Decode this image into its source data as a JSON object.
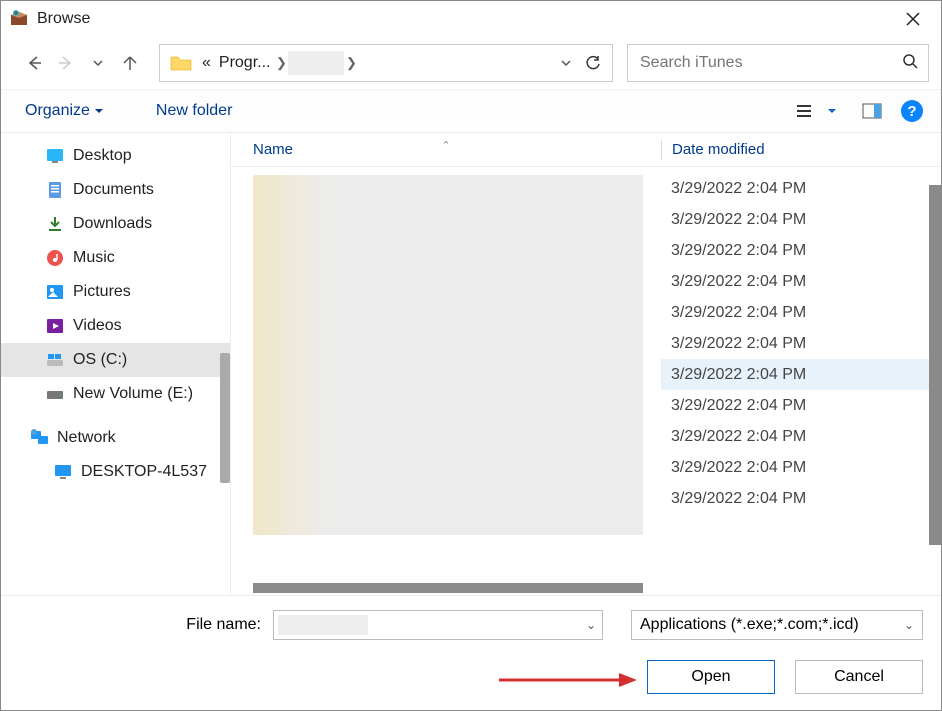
{
  "window": {
    "title": "Browse"
  },
  "nav": {
    "breadcrumb_root_glyph": "«",
    "breadcrumb_item1": "Progr...",
    "breadcrumb_item2_hidden": true
  },
  "search": {
    "placeholder": "Search iTunes"
  },
  "toolbar": {
    "organize": "Organize",
    "new_folder": "New folder"
  },
  "sidebar": {
    "items": [
      {
        "label": "Desktop",
        "icon": "desktop"
      },
      {
        "label": "Documents",
        "icon": "documents"
      },
      {
        "label": "Downloads",
        "icon": "downloads"
      },
      {
        "label": "Music",
        "icon": "music"
      },
      {
        "label": "Pictures",
        "icon": "pictures"
      },
      {
        "label": "Videos",
        "icon": "videos"
      },
      {
        "label": "OS (C:)",
        "icon": "drive",
        "selected": true
      },
      {
        "label": "New Volume (E:)",
        "icon": "drive2"
      }
    ],
    "network_label": "Network",
    "network_item": "DESKTOP-4L537"
  },
  "columns": {
    "name": "Name",
    "date": "Date modified"
  },
  "rows": [
    {
      "date": "3/29/2022 2:04 PM"
    },
    {
      "date": "3/29/2022 2:04 PM"
    },
    {
      "date": "3/29/2022 2:04 PM"
    },
    {
      "date": "3/29/2022 2:04 PM"
    },
    {
      "date": "3/29/2022 2:04 PM"
    },
    {
      "date": "3/29/2022 2:04 PM"
    },
    {
      "date": "3/29/2022 2:04 PM",
      "selected": true
    },
    {
      "date": "3/29/2022 2:04 PM"
    },
    {
      "date": "3/29/2022 2:04 PM"
    },
    {
      "date": "3/29/2022 2:04 PM"
    },
    {
      "date": "3/29/2022 2:04 PM"
    }
  ],
  "filename": {
    "label": "File name:",
    "value": "",
    "filter": "Applications (*.exe;*.com;*.icd)"
  },
  "buttons": {
    "open": "Open",
    "cancel": "Cancel"
  }
}
